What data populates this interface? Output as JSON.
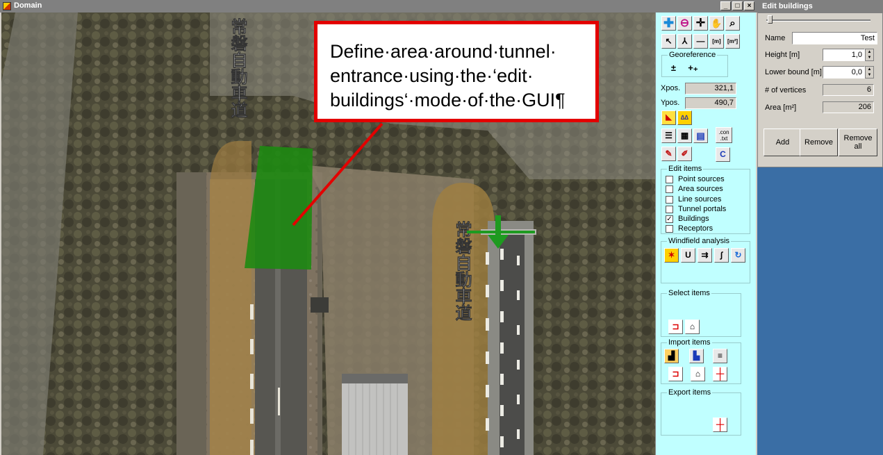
{
  "domain_window": {
    "title": "Domain",
    "controls": {
      "minimize": "_",
      "maximize": "□",
      "close": "×"
    }
  },
  "callout": {
    "text": "Define·area·around·tunnel· entrance·using·the·‘edit· buildings‘·mode·of·the·GUI¶"
  },
  "map_labels": {
    "road_text_left": "常磐自動車道",
    "road_text_right": "常磐自動車道"
  },
  "toolbar": {
    "row1": [
      "zoom-in-icon",
      "zoom-out-icon",
      "pan-cross-icon",
      "hand-icon",
      "magnifier-icon"
    ],
    "row2": [
      "pointer-icon",
      "walker-icon",
      "line-icon"
    ],
    "measure1": "[m]",
    "measure2": "[m²]"
  },
  "georeference": {
    "label": "Georeference",
    "btn1": "±",
    "btn2": "+₊"
  },
  "coords": {
    "xpos_label": "Xpos.",
    "xpos_value": "321,1",
    "ypos_label": "Ypos.",
    "ypos_value": "490,7"
  },
  "file_buttons": {
    "con_txt": ".con\n.txt",
    "c": "C"
  },
  "edit_items": {
    "label": "Edit items",
    "items": [
      {
        "label": "Point sources",
        "checked": false
      },
      {
        "label": "Area sources",
        "checked": false
      },
      {
        "label": "Line sources",
        "checked": false
      },
      {
        "label": "Tunnel portals",
        "checked": false
      },
      {
        "label": "Buildings",
        "checked": true
      },
      {
        "label": "Receptors",
        "checked": false
      }
    ]
  },
  "windfield": {
    "label": "Windfield analysis",
    "btn_u": "U"
  },
  "select_items": {
    "label": "Select items"
  },
  "import_items": {
    "label": "Import items"
  },
  "export_items": {
    "label": "Export items"
  },
  "edit_buildings": {
    "title": "Edit buildings",
    "name_label": "Name",
    "name_value": "Test",
    "height_label": "Height [m]",
    "height_value": "1,0",
    "lower_bound_label": "Lower bound  [m]",
    "lower_bound_value": "0,0",
    "vertices_label": "# of vertices",
    "vertices_value": "6",
    "area_label": "Area [m²]",
    "area_value": "206",
    "add_label": "Add",
    "remove_label": "Remove",
    "remove_all_label": "Remove all"
  }
}
